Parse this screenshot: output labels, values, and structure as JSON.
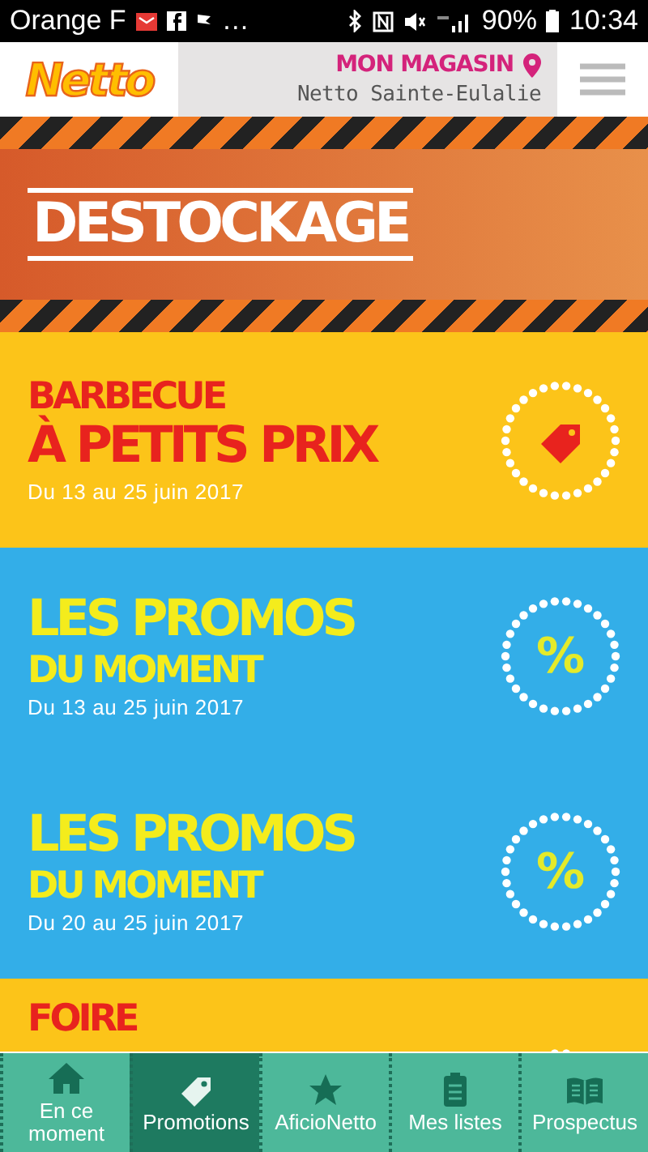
{
  "status_bar": {
    "carrier": "Orange F",
    "more": "…",
    "battery": "90%",
    "time": "10:34"
  },
  "header": {
    "logo": "Netto",
    "store_label": "MON MAGASIN",
    "store_name": "Netto Sainte-Eulalie"
  },
  "banner": {
    "title": "DESTOCKAGE"
  },
  "cards": [
    {
      "color": "#fcc419",
      "kind": "tag",
      "lines": [
        {
          "text": "BARBECUE",
          "big": false
        },
        {
          "text": "À PETITS PRIX",
          "big": true
        }
      ],
      "date": "Du 13 au 25 juin 2017"
    },
    {
      "color": "#33aee8",
      "kind": "percent",
      "symbol": "%",
      "lines": [
        {
          "text": "LES PROMOS",
          "big": true
        },
        {
          "text": "DU MOMENT",
          "big": false
        }
      ],
      "date": "Du 13 au 25 juin 2017"
    },
    {
      "color": "#33aee8",
      "kind": "percent",
      "symbol": "%",
      "lines": [
        {
          "text": "LES PROMOS",
          "big": true
        },
        {
          "text": "DU MOMENT",
          "big": false
        }
      ],
      "date": "Du 20 au 25 juin 2017"
    },
    {
      "color": "#fcc419",
      "kind": "partial",
      "lines": [
        {
          "text": "FOIRE",
          "big": false
        }
      ]
    }
  ],
  "bottom_nav": [
    {
      "kind": "home",
      "label": "En ce moment",
      "selected": false
    },
    {
      "kind": "tag",
      "label": "Promotions",
      "selected": true
    },
    {
      "kind": "star",
      "label": "AficioNetto",
      "selected": false
    },
    {
      "kind": "list",
      "label": "Mes listes",
      "selected": false
    },
    {
      "kind": "book",
      "label": "Prospectus",
      "selected": false
    }
  ]
}
